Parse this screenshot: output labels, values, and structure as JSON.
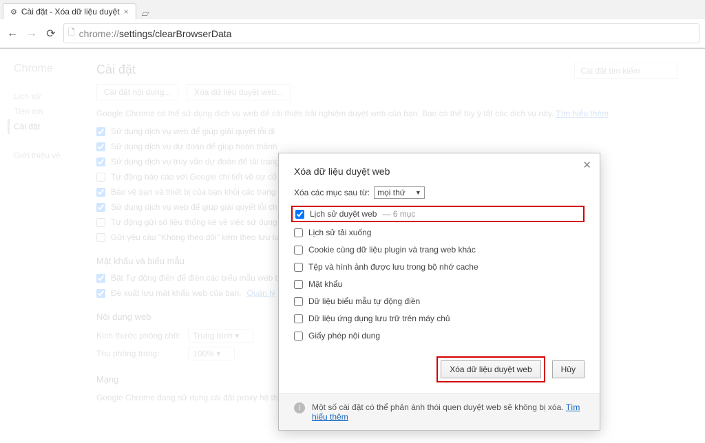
{
  "tab": {
    "title": "Cài đặt - Xóa dữ liệu duyệt"
  },
  "url": {
    "scheme": "chrome://",
    "path": "settings/clearBrowserData"
  },
  "sidebar": {
    "brand": "Chrome",
    "items": [
      "Lịch sử",
      "Tiện ích",
      "Cài đặt"
    ],
    "about": "Giới thiệu về"
  },
  "settings": {
    "title": "Cài đặt",
    "search_placeholder": "Cài đặt tìm kiếm",
    "btn_content": "Cài đặt nội dung...",
    "btn_clear": "Xóa dữ liệu duyệt web...",
    "privacy_desc": "Google Chrome có thể sử dụng dịch vụ web để cải thiện trải nghiệm duyệt web của bạn. Bạn có thể tùy ý tắt các dịch vụ này.",
    "learn_more": "Tìm hiểu thêm",
    "checks": [
      "Sử dụng dịch vụ web để giúp giải quyết lỗi đi",
      "Sử dụng dịch vụ dự đoán để giúp hoàn thành",
      "Sử dụng dịch vụ truy vấn dự đoán để tải trang",
      "Tự động báo cáo với Google chi tiết về sự cố",
      "Bảo vệ bạn và thiết bị của bạn khỏi các trang",
      "Sử dụng dịch vụ web để giúp giải quyết lỗi ch",
      "Tự động gửi số liệu thống kê về việc sử dụng",
      "Gửi yêu cầu \"Không theo dõi\" kèm theo lưu lư"
    ],
    "sec_passwords": "Mật khẩu và biểu mẫu",
    "pw1": "Bật Tự động điền để điền các biểu mẫu web b",
    "pw2": "Đề xuất lưu mật khẩu web của bạn.",
    "manage": "Quản lý",
    "sec_web": "Nội dung web",
    "font_label": "Kích thước phông chữ:",
    "font_value": "Trung bình",
    "zoom_label": "Thu phóng trang:",
    "zoom_value": "100%",
    "sec_net": "Mạng",
    "net_desc": "Google Chrome đang sử dụng cài đặt proxy hệ thống trên máy tính của bạn để kết nối mạng."
  },
  "dialog": {
    "title": "Xóa dữ liệu duyệt web",
    "time_label": "Xóa các mục sau từ:",
    "time_value": "mọi thứ",
    "options": [
      {
        "label": "Lịch sử duyệt web",
        "count": "— 6 mục",
        "checked": true,
        "highlight": true
      },
      {
        "label": "Lịch sử tải xuống",
        "checked": false
      },
      {
        "label": "Cookie cùng dữ liệu plugin và trang web khác",
        "checked": false
      },
      {
        "label": "Tệp và hình ảnh được lưu trong bộ nhớ cache",
        "checked": false
      },
      {
        "label": "Mật khẩu",
        "checked": false
      },
      {
        "label": "Dữ liệu biểu mẫu tự động điền",
        "checked": false
      },
      {
        "label": "Dữ liệu ứng dụng lưu trữ trên máy chủ",
        "checked": false
      },
      {
        "label": "Giấy phép nội dung",
        "checked": false
      }
    ],
    "btn_clear": "Xóa dữ liệu duyệt web",
    "btn_cancel": "Hủy",
    "footer_text": "Một số cài đặt có thể phản ánh thói quen duyệt web sẽ không bị xóa.",
    "footer_link": "Tìm hiểu thêm"
  }
}
